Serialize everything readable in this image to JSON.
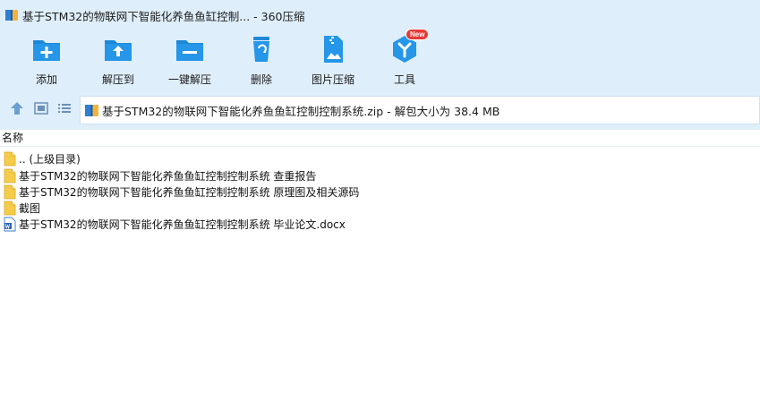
{
  "window": {
    "title": "基于STM32的物联网下智能化养鱼鱼缸控制... - 360压缩"
  },
  "colors": {
    "chrome_bg": "#dfeefb",
    "icon_blue": "#1e88d8",
    "folder_yellow": "#f5cc4a",
    "badge_red": "#e53935"
  },
  "toolbar": {
    "add": "添加",
    "extract_to": "解压到",
    "one_click_extract": "一键解压",
    "delete": "删除",
    "image_compress": "图片压缩",
    "tools": "工具",
    "tools_badge": "New"
  },
  "address": {
    "path": "基于STM32的物联网下智能化养鱼鱼缸控制控制系统.zip - 解包大小为 38.4 MB"
  },
  "filelist": {
    "column_name": "名称",
    "items": [
      {
        "name": ".. (上级目录)",
        "type": "folder"
      },
      {
        "name": "基于STM32的物联网下智能化养鱼鱼缸控制控制系统 查重报告",
        "type": "folder"
      },
      {
        "name": "基于STM32的物联网下智能化养鱼鱼缸控制控制系统 原理图及相关源码",
        "type": "folder"
      },
      {
        "name": "截图",
        "type": "folder"
      },
      {
        "name": "基于STM32的物联网下智能化养鱼鱼缸控制控制系统 毕业论文.docx",
        "type": "docx"
      }
    ]
  }
}
